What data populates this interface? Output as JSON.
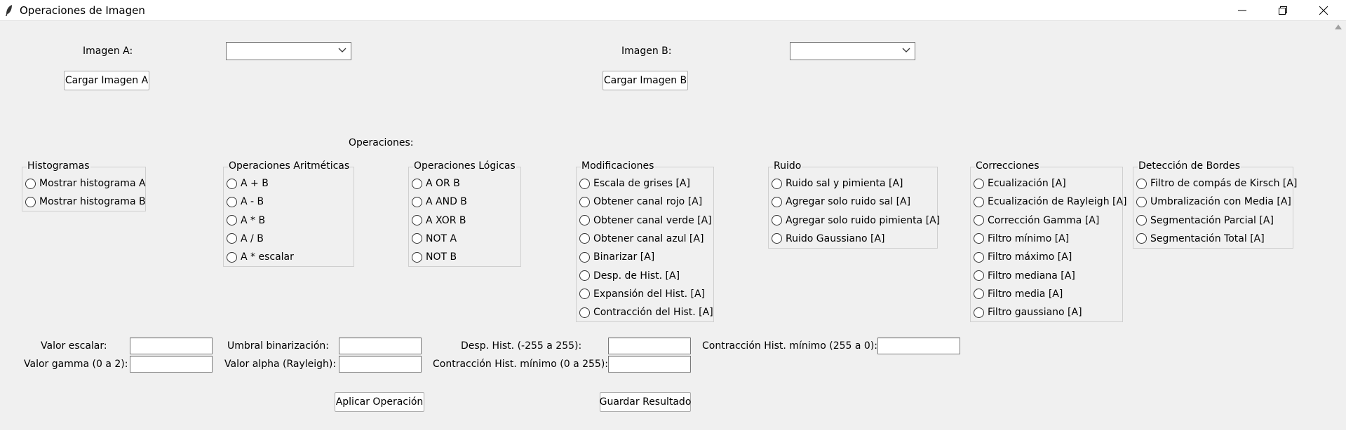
{
  "window": {
    "title": "Operaciones de Imagen"
  },
  "image_a": {
    "label": "Imagen A:",
    "selected": "",
    "load_button": "Cargar Imagen A"
  },
  "image_b": {
    "label": "Imagen B:",
    "selected": "",
    "load_button": "Cargar Imagen B"
  },
  "operations_label": "Operaciones:",
  "groups": {
    "histogramas": {
      "title": "Histogramas",
      "options": [
        "Mostrar histograma A",
        "Mostrar histograma B"
      ]
    },
    "aritmeticas": {
      "title": "Operaciones Aritméticas",
      "options": [
        "A + B",
        "A - B",
        "A * B",
        "A / B",
        "A * escalar"
      ]
    },
    "logicas": {
      "title": "Operaciones Lógicas",
      "options": [
        "A OR B",
        "A AND B",
        "A XOR B",
        "NOT A",
        "NOT B"
      ]
    },
    "modificaciones": {
      "title": "Modificaciones",
      "options": [
        "Escala de grises [A]",
        "Obtener canal rojo [A]",
        "Obtener canal verde [A]",
        "Obtener canal azul [A]",
        "Binarizar [A]",
        "Desp. de Hist. [A]",
        "Expansión del Hist. [A]",
        "Contracción del Hist. [A]"
      ]
    },
    "ruido": {
      "title": "Ruido",
      "options": [
        "Ruido sal y pimienta [A]",
        "Agregar solo ruido sal [A]",
        "Agregar solo ruido pimienta [A]",
        "Ruido Gaussiano [A]"
      ]
    },
    "correcciones": {
      "title": "Correcciones",
      "options": [
        "Ecualización [A]",
        "Ecualización de Rayleigh [A]",
        "Corrección Gamma [A]",
        "Filtro mínimo [A]",
        "Filtro máximo [A]",
        "Filtro mediana [A]",
        "Filtro media [A]",
        "Filtro gaussiano [A]"
      ]
    },
    "bordes": {
      "title": "Detección de Bordes",
      "options": [
        "Filtro de compás de Kirsch [A]",
        "Umbralización con Media [A]",
        "Segmentación Parcial [A]",
        "Segmentación Total [A]"
      ]
    }
  },
  "params": {
    "valor_escalar": {
      "label": "Valor escalar:",
      "value": ""
    },
    "umbral_binarizacion": {
      "label": "Umbral binarización:",
      "value": ""
    },
    "desp_hist": {
      "label": "Desp. Hist. (-255 a 255):",
      "value": ""
    },
    "contraccion_max": {
      "label": "Contracción Hist. mínimo (255 a 0):",
      "value": ""
    },
    "valor_gamma": {
      "label": "Valor gamma (0 a 2):",
      "value": ""
    },
    "valor_alpha": {
      "label": "Valor alpha (Rayleigh):",
      "value": ""
    },
    "contraccion_min": {
      "label": "Contracción Hist. mínimo (0 a 255):",
      "value": ""
    }
  },
  "actions": {
    "apply": "Aplicar Operación",
    "save": "Guardar Resultado"
  },
  "icons": {
    "app": "feather-icon",
    "minimize": "minimize-icon",
    "maximize": "restore-icon",
    "close": "close-icon",
    "dropdown": "chevron-down-icon",
    "scroll": "scroll-up-arrow-icon"
  }
}
